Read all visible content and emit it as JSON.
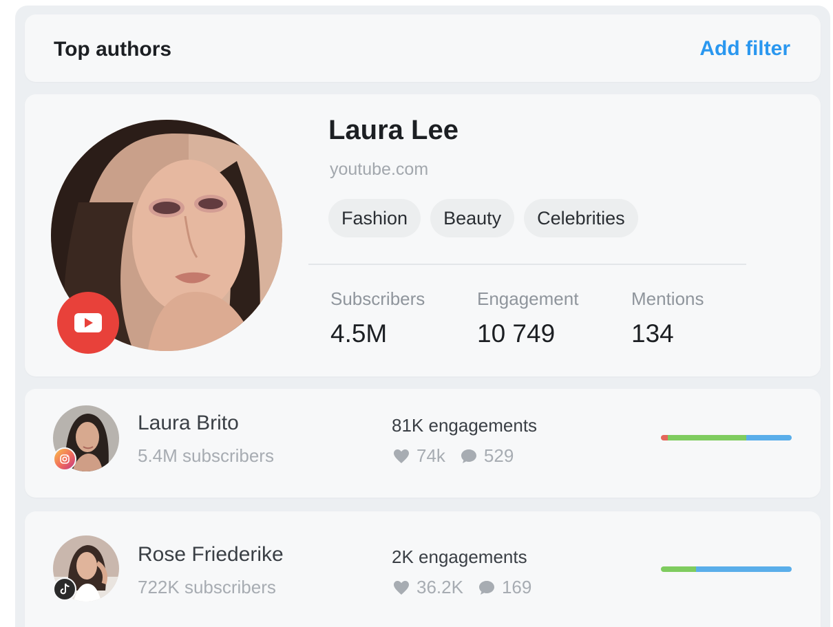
{
  "header": {
    "title": "Top authors",
    "add_filter_label": "Add filter"
  },
  "featured": {
    "name": "Laura Lee",
    "domain": "youtube.com",
    "platform_icon": "youtube-icon",
    "tags": [
      "Fashion",
      "Beauty",
      "Celebrities"
    ],
    "stats": [
      {
        "label": "Subscribers",
        "value": "4.5M"
      },
      {
        "label": "Engagement",
        "value": "10 749"
      },
      {
        "label": "Mentions",
        "value": "134"
      }
    ]
  },
  "authors": [
    {
      "name": "Laura Brito",
      "subscribers": "5.4M subscribers",
      "engagements": "81K engagements",
      "likes": "74k",
      "comments": "529",
      "platform_icon": "instagram-icon",
      "sentiment_bar": {
        "negative": 0.05,
        "neutral": 0.6,
        "positive": 0.35
      }
    },
    {
      "name": "Rose Friederike",
      "subscribers": "722K subscribers",
      "engagements": "2K engagements",
      "likes": "36.2K",
      "comments": "169",
      "platform_icon": "tiktok-icon",
      "sentiment_bar": {
        "negative": 0,
        "neutral": 0.27,
        "positive": 0.73
      }
    }
  ],
  "colors": {
    "accent": "#2a97ef",
    "youtube": "#e8413a",
    "bar_negative": "#e4675b",
    "bar_neutral": "#7fcc5f",
    "bar_positive": "#5aaeea"
  }
}
